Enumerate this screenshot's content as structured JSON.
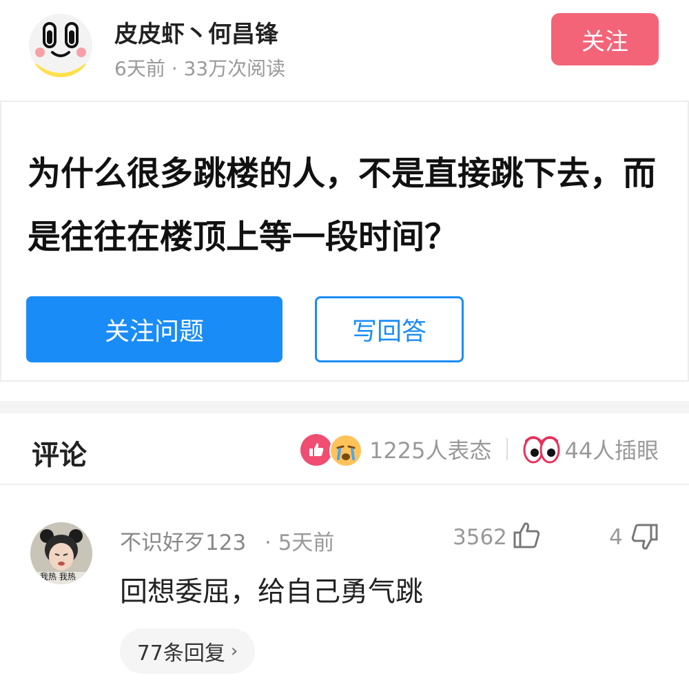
{
  "author": {
    "name": "皮皮虾丶何昌锋",
    "meta": "6天前 · 33万次阅读",
    "follow_label": "关注"
  },
  "question": {
    "title": "为什么很多跳楼的人，不是直接跳下去，而是往往在楼顶上等一段时间？",
    "follow_label": "关注问题",
    "answer_label": "写回答"
  },
  "comments_section": {
    "title": "评论",
    "reactions_count": "1225人表态",
    "eyes_count": "44人插眼"
  },
  "comment": {
    "user": "不识好歹123",
    "time": "· 5天前",
    "likes": "3562",
    "dislikes": "4",
    "text": "回想委屈，给自己勇气跳",
    "replies_label": "77条回复",
    "avatar_caption": "我热 我热"
  },
  "colors": {
    "follow_pink": "#f36478",
    "primary_blue": "#1a8cf7"
  }
}
